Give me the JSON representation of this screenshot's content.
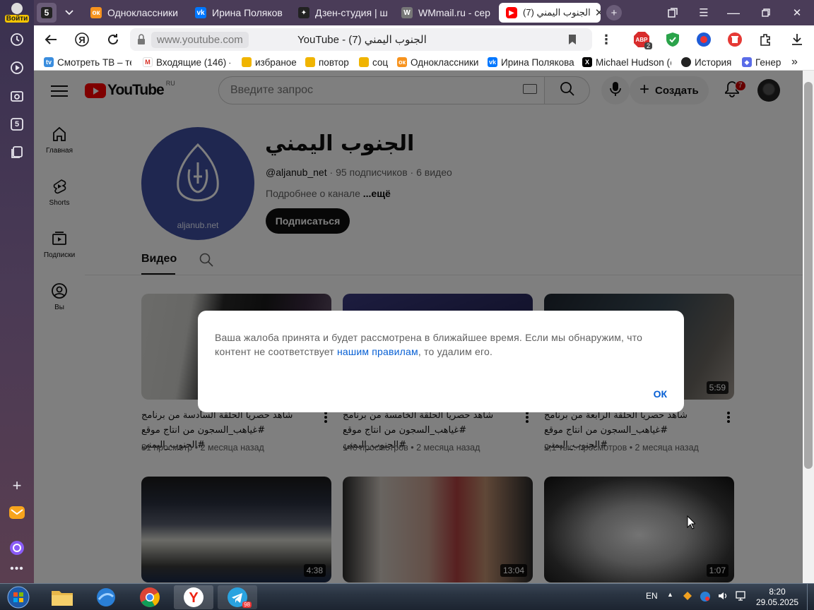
{
  "sidebar": {
    "login_label": "Войти",
    "tabs_counter": "5"
  },
  "tabs": [
    {
      "label": "5",
      "icon": "tab-counter-icon"
    },
    {
      "label": "Одноклассники",
      "icon": "odnoklassniki-icon"
    },
    {
      "label": "Ирина Полякова",
      "icon": "vk-icon"
    },
    {
      "label": "Дзен-студия | ш",
      "icon": "dzen-icon"
    },
    {
      "label": "WMmail.ru - сер",
      "icon": "wmmail-icon"
    },
    {
      "label": "(7) الجنوب اليمني",
      "icon": "youtube-icon",
      "active": true
    }
  ],
  "toolbar": {
    "url_domain": "www.youtube.com",
    "url_title": "YouTube - الجنوب اليمني (7)",
    "ext_badge": "2"
  },
  "bookmarks": [
    {
      "label": "Смотреть ТВ – те",
      "icon": "tv-icon"
    },
    {
      "label": "Входящие (146) -",
      "icon": "gmail-icon"
    },
    {
      "label": "избраное",
      "icon": "folder-icon"
    },
    {
      "label": "повтор",
      "icon": "folder-icon"
    },
    {
      "label": "соц",
      "icon": "folder-icon"
    },
    {
      "label": "Одноклассники",
      "icon": "odnoklassniki-icon"
    },
    {
      "label": "Ирина Полякова",
      "icon": "vk-icon"
    },
    {
      "label": "Michael Hudson (@",
      "icon": "x-icon"
    },
    {
      "label": "История",
      "icon": "history-icon"
    },
    {
      "label": "Генера",
      "icon": "generator-icon"
    }
  ],
  "yt": {
    "logo_region": "RU",
    "search_placeholder": "Введите запрос",
    "create_label": "Создать",
    "notifications": "7"
  },
  "guide": [
    {
      "label": "Главная",
      "icon": "home-icon"
    },
    {
      "label": "Shorts",
      "icon": "shorts-icon"
    },
    {
      "label": "Подписки",
      "icon": "subscriptions-icon"
    },
    {
      "label": "Вы",
      "icon": "you-icon"
    }
  ],
  "channel": {
    "name": "الجنوب اليمني",
    "handle": "@aljanub_net",
    "subscribers": "95 подписчиков",
    "videos": "6 видео",
    "about": "Подробнее о канале",
    "about_more": "...ещё",
    "subscribe_label": "Подписаться",
    "avatar_domain": "aljanub.net",
    "tab_video": "Видео"
  },
  "videos": [
    {
      "title": "شاهد حصريا الحلقة السادسة من برنامج #غياهب_السجون من انتاج موقع #الجنوب_اليمني",
      "views": "81 просмотр",
      "age": "2 месяца назад",
      "duration": ""
    },
    {
      "title": "شاهد حصريا الحلقة الخامسة من برنامج #غياهب_السجون من انتاج موقع #الجنوب_اليمني",
      "views": "140 просмотров",
      "age": "2 месяца назад",
      "duration": ""
    },
    {
      "title": "شاهد حصريا الحلقة الرابعة من برنامج #غياهب_السجون من انتاج موقع #الجنوب_اليمني",
      "views": "2,1 тыс. просмотров",
      "age": "2 месяца назад",
      "duration": "5:59"
    },
    {
      "title": "",
      "views": "",
      "age": "",
      "duration": "4:38"
    },
    {
      "title": "",
      "views": "",
      "age": "",
      "duration": "13:04"
    },
    {
      "title": "",
      "views": "",
      "age": "",
      "duration": "1:07"
    }
  ],
  "dialog": {
    "text_before": "Ваша жалоба принята и будет рассмотрена в ближайшее время. Если мы обнаружим, что контент не соответствует ",
    "link": "нашим правилам",
    "text_after": ", то удалим его.",
    "ok_label": "ОК"
  },
  "taskbar": {
    "lang": "EN",
    "time": "8:20",
    "date": "29.05.2025",
    "telegram_badge": "98"
  },
  "colors": {
    "youtube_red": "#ff0000",
    "link_blue": "#065fd4",
    "channel_avatar": "#3f4fa0"
  }
}
